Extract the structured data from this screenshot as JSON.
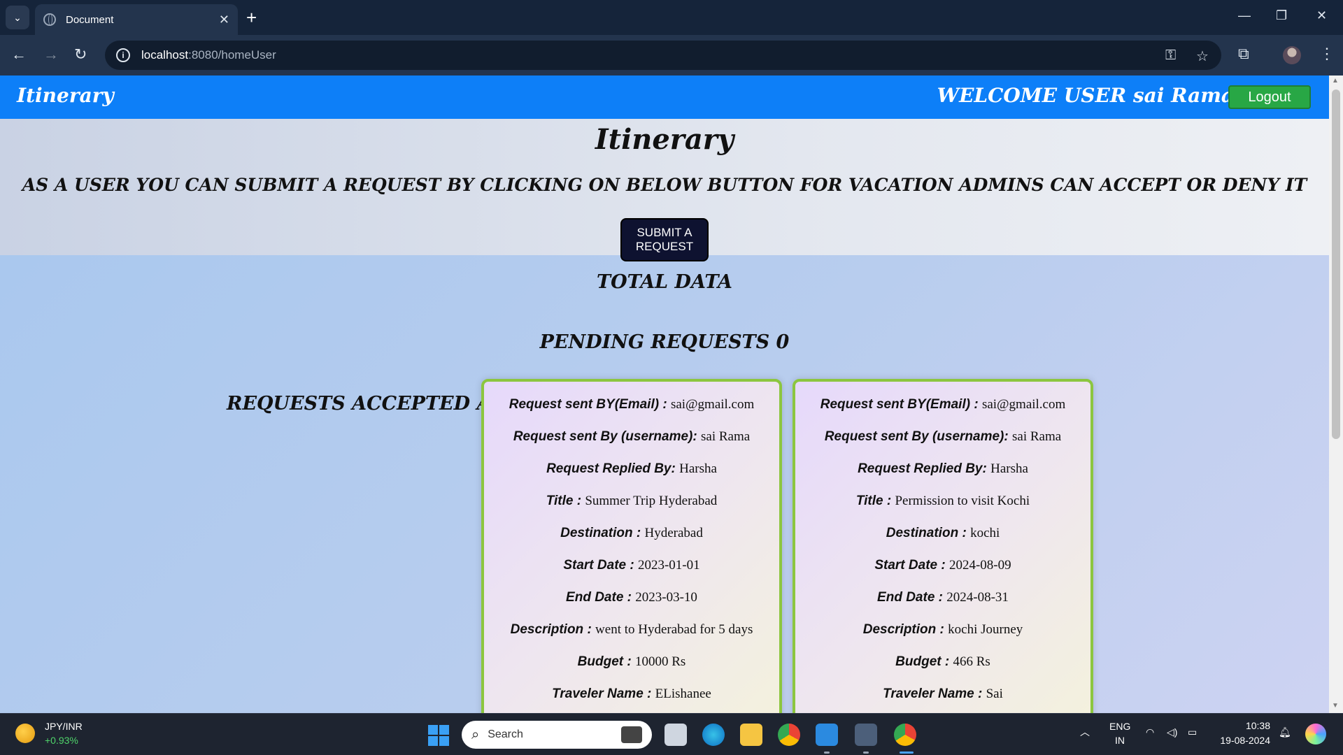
{
  "browser": {
    "tab_title": "Document",
    "close_glyph": "✕",
    "new_tab_glyph": "+",
    "url_host": "localhost",
    "url_path": ":8080/homeUser",
    "icons": [
      "back-arrow-icon",
      "forward-arrow-icon",
      "reload-icon",
      "site-info-icon",
      "password-key-icon",
      "bookmark-star-icon",
      "extensions-icon",
      "profile-avatar",
      "menu-dots-icon"
    ]
  },
  "navbar": {
    "brand": "Itinerary",
    "welcome": "WELCOME USER sai Rama",
    "logout_label": "Logout",
    "background_color": "#0d7ff8",
    "logout_color": "#28a745"
  },
  "hero": {
    "title": "Itinerary",
    "subtitle": "AS A USER YOU CAN SUBMIT A REQUEST BY CLICKING ON BELOW BUTTON FOR VACATION ADMINS CAN ACCEPT OR DENY IT",
    "submit_line1": "SUBMIT A",
    "submit_line2": "REQUEST"
  },
  "main": {
    "total_data_title": "TOTAL DATA",
    "pending_title": "PENDING REQUESTS 0",
    "accepted_label": "REQUESTS ACCEPTED ARE:",
    "card_border_color": "#8cc63f",
    "labels": {
      "email": "Request sent BY(Email) :",
      "username": "Request sent By (username):",
      "replied": "Request Replied By:",
      "title": "Title :",
      "destination": "Destination :",
      "start": "Start Date :",
      "end": "End Date :",
      "description": "Description :",
      "budget": "Budget :",
      "traveler": "Traveler Name :"
    },
    "cards": [
      {
        "email": "sai@gmail.com",
        "username": "sai Rama",
        "replied": "Harsha",
        "title": "Summer Trip Hyderabad",
        "destination": "Hyderabad",
        "start": "2023-01-01",
        "end": "2023-03-10",
        "description": "went to Hyderabad for 5 days",
        "budget": "10000 Rs",
        "traveler": "ELishanee"
      },
      {
        "email": "sai@gmail.com",
        "username": "sai Rama",
        "replied": "Harsha",
        "title": "Permission to visit Kochi",
        "destination": "kochi",
        "start": "2024-08-09",
        "end": "2024-08-31",
        "description": "kochi Journey",
        "budget": "466 Rs",
        "traveler": "Sai"
      }
    ]
  },
  "taskbar": {
    "widget_title": "JPY/INR",
    "widget_change": "+0.93%",
    "search_label": "Search",
    "lang_top": "ENG",
    "lang_bottom": "IN",
    "time": "10:38",
    "date": "19-08-2024"
  }
}
